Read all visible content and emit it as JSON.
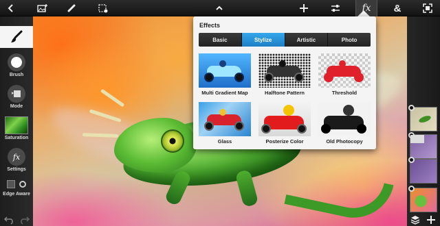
{
  "toolbar": {
    "icons": [
      "back-icon",
      "image-add-icon",
      "brush-icon",
      "select-settings-icon",
      "expand-up-icon",
      "add-icon",
      "adjustments-icon",
      "fx-icon",
      "ampersand-icon",
      "fullscreen-icon"
    ],
    "fx_label": "fx",
    "amp_label": "&"
  },
  "left_tools": {
    "items": [
      {
        "label": "Brush",
        "icon": "brush-size-icon"
      },
      {
        "label": "Mode",
        "icon": "mode-icon"
      },
      {
        "label": "Saturation",
        "icon": "saturation-swatch-icon"
      },
      {
        "label": "Settings",
        "icon": "fx-settings-icon"
      },
      {
        "label": "Edge Aware",
        "icon": "edge-aware-toggle-icon"
      }
    ],
    "fx_glyph": "fx"
  },
  "effects": {
    "title": "Effects",
    "tabs": [
      {
        "label": "Basic",
        "selected": false
      },
      {
        "label": "Stylize",
        "selected": true
      },
      {
        "label": "Artistic",
        "selected": false
      },
      {
        "label": "Photo",
        "selected": false
      }
    ],
    "items": [
      {
        "label": "Multi Gradient Map"
      },
      {
        "label": "Halftone Pattern"
      },
      {
        "label": "Threshold"
      },
      {
        "label": "Glass"
      },
      {
        "label": "Posterize Color"
      },
      {
        "label": "Old Photocopy"
      }
    ]
  },
  "colors": {
    "tab_selected": "#2a93d8",
    "toolbar_bg": "#1c1c1c",
    "panel_bg": "#f4f4f4"
  }
}
